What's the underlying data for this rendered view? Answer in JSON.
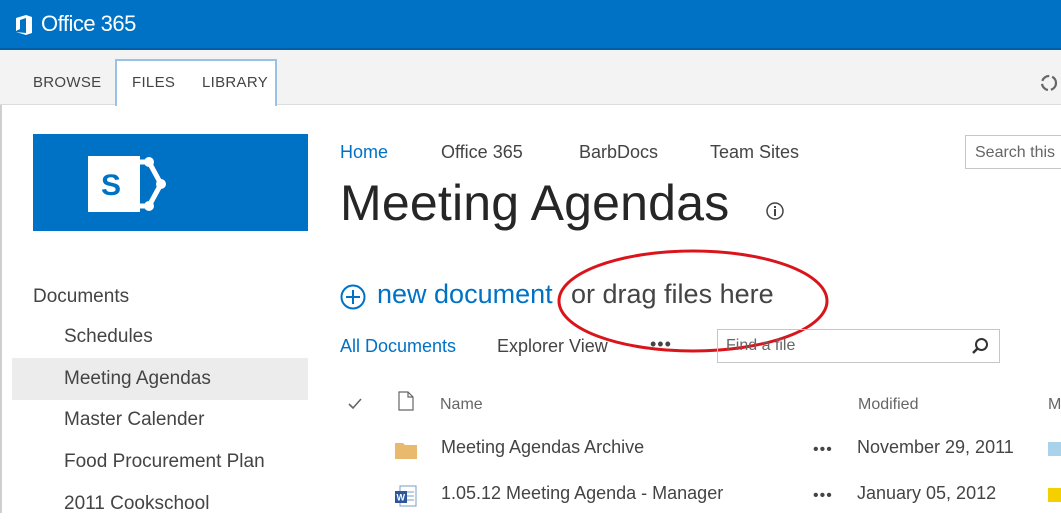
{
  "suite": {
    "title": "Office 365"
  },
  "ribbon": {
    "tabs": [
      "BROWSE",
      "FILES",
      "LIBRARY"
    ]
  },
  "nav": {
    "heading": "Documents",
    "items": [
      "Schedules",
      "Meeting Agendas",
      "Master Calender",
      "Food Procurement Plan",
      "2011 Cookschool"
    ],
    "selected": "Meeting Agendas"
  },
  "topnav": {
    "links": [
      "Home",
      "Office 365",
      "BarbDocs",
      "Team Sites"
    ],
    "search_placeholder": "Search this"
  },
  "page": {
    "title": "Meeting Agendas"
  },
  "newdoc": {
    "link": "new document",
    "drag": "or drag files here"
  },
  "views": {
    "all": "All Documents",
    "explorer": "Explorer View",
    "more": "•••",
    "find_placeholder": "Find a file"
  },
  "table": {
    "headers": {
      "name": "Name",
      "modified": "Modified",
      "modified_by": "M"
    },
    "rows": [
      {
        "icon": "folder-icon",
        "name": "Meeting Agendas Archive",
        "dots": "•••",
        "modified": "November 29, 2011",
        "swatch": "#a9d3ea"
      },
      {
        "icon": "word-doc-icon",
        "name": "1.05.12 Meeting Agenda - Manager",
        "dots": "•••",
        "modified": "January 05, 2012",
        "swatch": "#f5d000"
      }
    ]
  },
  "colors": {
    "brand": "#0072c6",
    "highlight_ellipse": "#d9141b"
  }
}
